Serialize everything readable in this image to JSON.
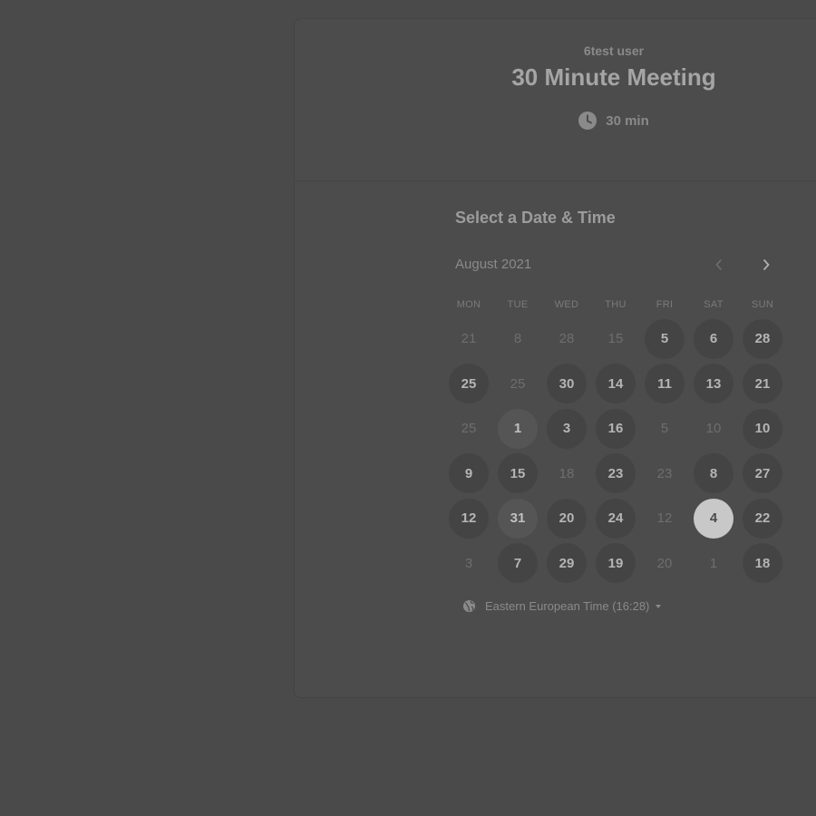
{
  "header": {
    "host": "6test user",
    "title": "30 Minute Meeting",
    "duration": "30 min",
    "duration_icon": "clock-icon"
  },
  "picker": {
    "title": "Select a Date & Time",
    "month": "August 2021",
    "prev_icon": "chevron-left-icon",
    "next_icon": "chevron-right-icon",
    "weekdays": [
      "MON",
      "TUE",
      "WED",
      "THU",
      "FRI",
      "SAT",
      "SUN"
    ],
    "weeks": [
      [
        {
          "d": "21",
          "a": false
        },
        {
          "d": "8",
          "a": false
        },
        {
          "d": "28",
          "a": false
        },
        {
          "d": "15",
          "a": false
        },
        {
          "d": "5",
          "a": true
        },
        {
          "d": "6",
          "a": true
        },
        {
          "d": "28",
          "a": true
        }
      ],
      [
        {
          "d": "25",
          "a": true
        },
        {
          "d": "25",
          "a": false
        },
        {
          "d": "30",
          "a": true
        },
        {
          "d": "14",
          "a": true
        },
        {
          "d": "11",
          "a": true
        },
        {
          "d": "13",
          "a": true
        },
        {
          "d": "21",
          "a": true
        }
      ],
      [
        {
          "d": "25",
          "a": false
        },
        {
          "d": "1",
          "a": true,
          "h": true
        },
        {
          "d": "3",
          "a": true
        },
        {
          "d": "16",
          "a": true
        },
        {
          "d": "5",
          "a": false
        },
        {
          "d": "10",
          "a": false
        },
        {
          "d": "10",
          "a": true
        }
      ],
      [
        {
          "d": "9",
          "a": true
        },
        {
          "d": "15",
          "a": true
        },
        {
          "d": "18",
          "a": false
        },
        {
          "d": "23",
          "a": true
        },
        {
          "d": "23",
          "a": false
        },
        {
          "d": "8",
          "a": true
        },
        {
          "d": "27",
          "a": true
        }
      ],
      [
        {
          "d": "12",
          "a": true
        },
        {
          "d": "31",
          "a": true,
          "h": true
        },
        {
          "d": "20",
          "a": true
        },
        {
          "d": "24",
          "a": true
        },
        {
          "d": "12",
          "a": false
        },
        {
          "d": "4",
          "a": true,
          "s": true
        },
        {
          "d": "22",
          "a": true
        }
      ],
      [
        {
          "d": "3",
          "a": false
        },
        {
          "d": "7",
          "a": true
        },
        {
          "d": "29",
          "a": true
        },
        {
          "d": "19",
          "a": true
        },
        {
          "d": "20",
          "a": false
        },
        {
          "d": "1",
          "a": false
        },
        {
          "d": "18",
          "a": true
        }
      ]
    ]
  },
  "timezone": {
    "label": "Eastern European Time (16:28)",
    "icon": "globe-icon"
  },
  "colors": {
    "background": "#4a4a4a",
    "available_day": "#444444",
    "selected_day": "#c8c8c8"
  }
}
